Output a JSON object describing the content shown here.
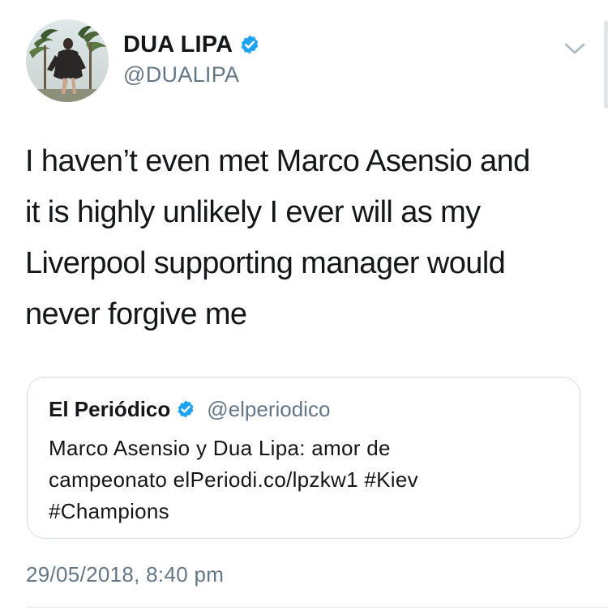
{
  "tweet": {
    "author": {
      "display_name": "DUA LIPA",
      "handle": "@DUALIPA",
      "verified": true,
      "avatar_icon": "profile-photo"
    },
    "menu_icon": "chevron-down-icon",
    "text": "I haven’t even met Marco Asensio and\nit is highly unlikely I ever will as my\nLiverpool supporting manager would\nnever forgive me",
    "timestamp": "29/05/2018, 8:40 pm",
    "quoted": {
      "display_name": "El Periódico",
      "handle": "@elperiodico",
      "verified": true,
      "text": "Marco Asensio y Dua Lipa: amor de\ncampeonato elPeriodi.co/lpzkw1 #Kiev\n#Champions"
    }
  },
  "colors": {
    "verified_blue": "#1da1f2",
    "secondary_text": "#657786",
    "primary_text": "#14171a",
    "border": "#d3dbe2"
  }
}
